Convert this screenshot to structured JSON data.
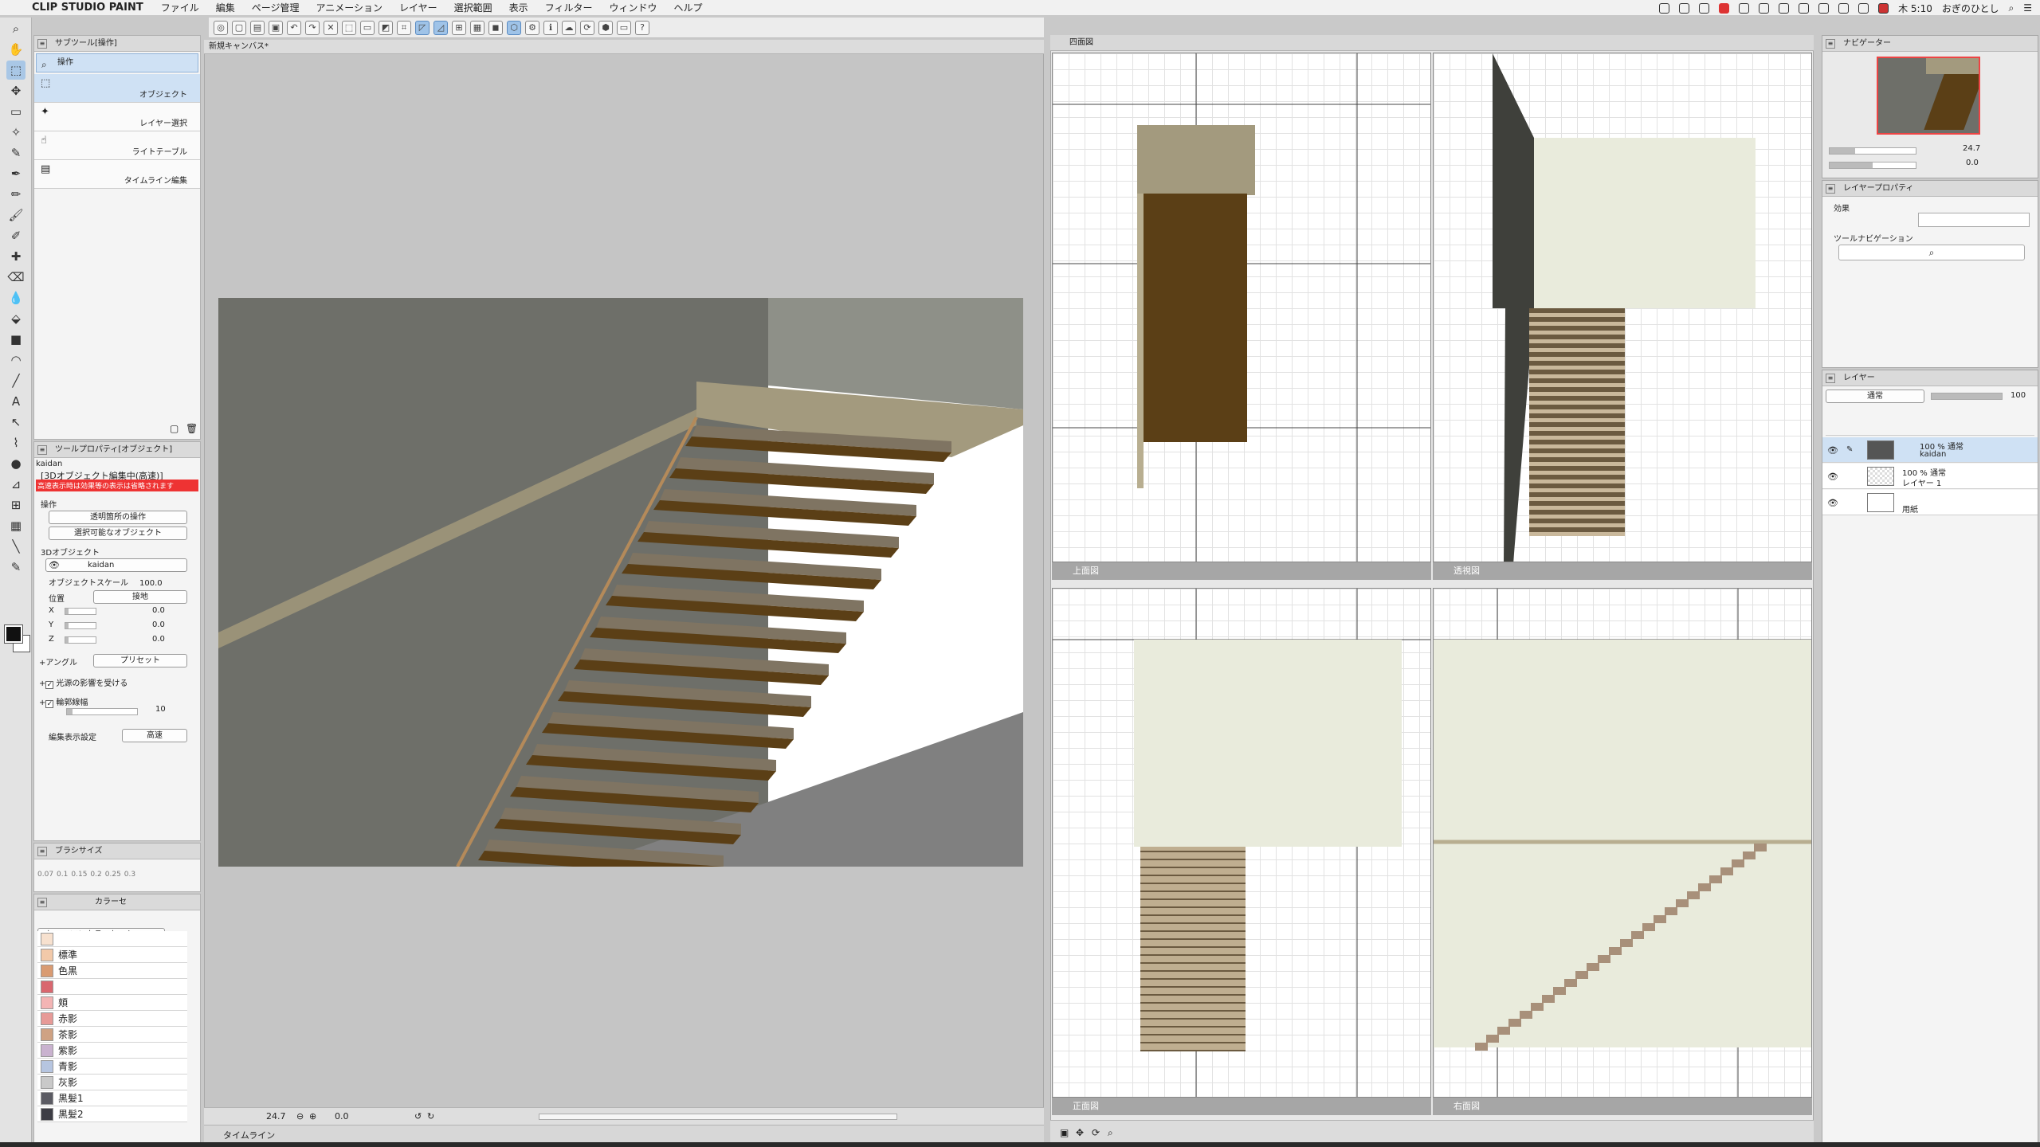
{
  "menubar": {
    "app": "CLIP STUDIO PAINT",
    "items": [
      "ファイル",
      "編集",
      "ページ管理",
      "アニメーション",
      "レイヤー",
      "選択範囲",
      "表示",
      "フィルター",
      "ウィンドウ",
      "ヘルプ"
    ],
    "clock": "木 5:10",
    "user": "おぎのひとし"
  },
  "subtool": {
    "header": "サブツール[操作]",
    "group": "操作",
    "items": [
      "オブジェクト",
      "レイヤー選択",
      "ライトテーブル",
      "タイムライン編集"
    ]
  },
  "toolprop": {
    "header": "ツールプロパティ[オブジェクト]",
    "object_name": "kaidan",
    "notice1": "[3Dオブジェクト編集中(高速)]",
    "notice2": "高速表示時は効果等の表示は省略されます",
    "op_label": "操作",
    "op_dd1": "透明箇所の操作",
    "op_dd2": "選択可能なオブジェクト",
    "obj3d_label": "3Dオブジェクト",
    "obj_dd": "kaidan",
    "scale_label": "オブジェクトスケール",
    "scale_value": "100.0",
    "pos_label": "位置",
    "ground_btn": "接地",
    "x_label": "X",
    "x_value": "0.0",
    "y_label": "Y",
    "y_value": "0.0",
    "z_label": "Z",
    "z_value": "0.0",
    "angle_label": "アングル",
    "preset_btn": "プリセット",
    "light_label": "光源の影響を受ける",
    "outline_label": "輪郭線幅",
    "outline_value": "10",
    "display_label": "編集表示設定",
    "display_value": "高速"
  },
  "brushsize": {
    "header": "ブラシサイズ",
    "sizes": [
      "0.07",
      "0.1",
      "0.15",
      "0.2",
      "0.25",
      "0.3"
    ]
  },
  "colorset": {
    "header": "カラーセ",
    "set_name": "ヒューマンカラーセット",
    "rows": [
      {
        "label": "",
        "color": "#f7e1cf"
      },
      {
        "label": "標準",
        "color": "#f2c9a9"
      },
      {
        "label": "色黒",
        "color": "#d99b72"
      },
      {
        "label": "",
        "color": "#d9676f"
      },
      {
        "label": "頬",
        "color": "#f3b4b4"
      },
      {
        "label": "赤影",
        "color": "#e79a97"
      },
      {
        "label": "茶影",
        "color": "#cfa283"
      },
      {
        "label": "紫影",
        "color": "#c9b2cf"
      },
      {
        "label": "青影",
        "color": "#b6c5e0"
      },
      {
        "label": "灰影",
        "color": "#c9c9c9"
      },
      {
        "label": "黒髪1",
        "color": "#5b5b63"
      },
      {
        "label": "黒髪2",
        "color": "#3d3d45"
      }
    ]
  },
  "canvas": {
    "tab": "新規キャンバス*",
    "zoom": "24.7",
    "angle": "0.0",
    "timeline": "タイムライン"
  },
  "fourview": {
    "tab": "四面図",
    "views": [
      "上面図",
      "透視図",
      "正面図",
      "右面図"
    ]
  },
  "navigator": {
    "header": "ナビゲーター",
    "zoom": "24.7",
    "rot": "0.0"
  },
  "layerprop": {
    "header": "レイヤープロパティ",
    "effect": "効果",
    "toolnav": "ツールナビゲーション"
  },
  "layers": {
    "header": "レイヤー",
    "blend": "通常",
    "opacity": "100",
    "rows": [
      {
        "l1": "100 % 通常",
        "l2": "kaidan"
      },
      {
        "l1": "100 % 通常",
        "l2": "レイヤー 1"
      },
      {
        "l1": "",
        "l2": "用紙"
      }
    ]
  },
  "colors": {
    "wall": "#6e6f69",
    "floor": "#a39a7e",
    "tread": "#5b3f16",
    "riser": "#7f7462"
  }
}
